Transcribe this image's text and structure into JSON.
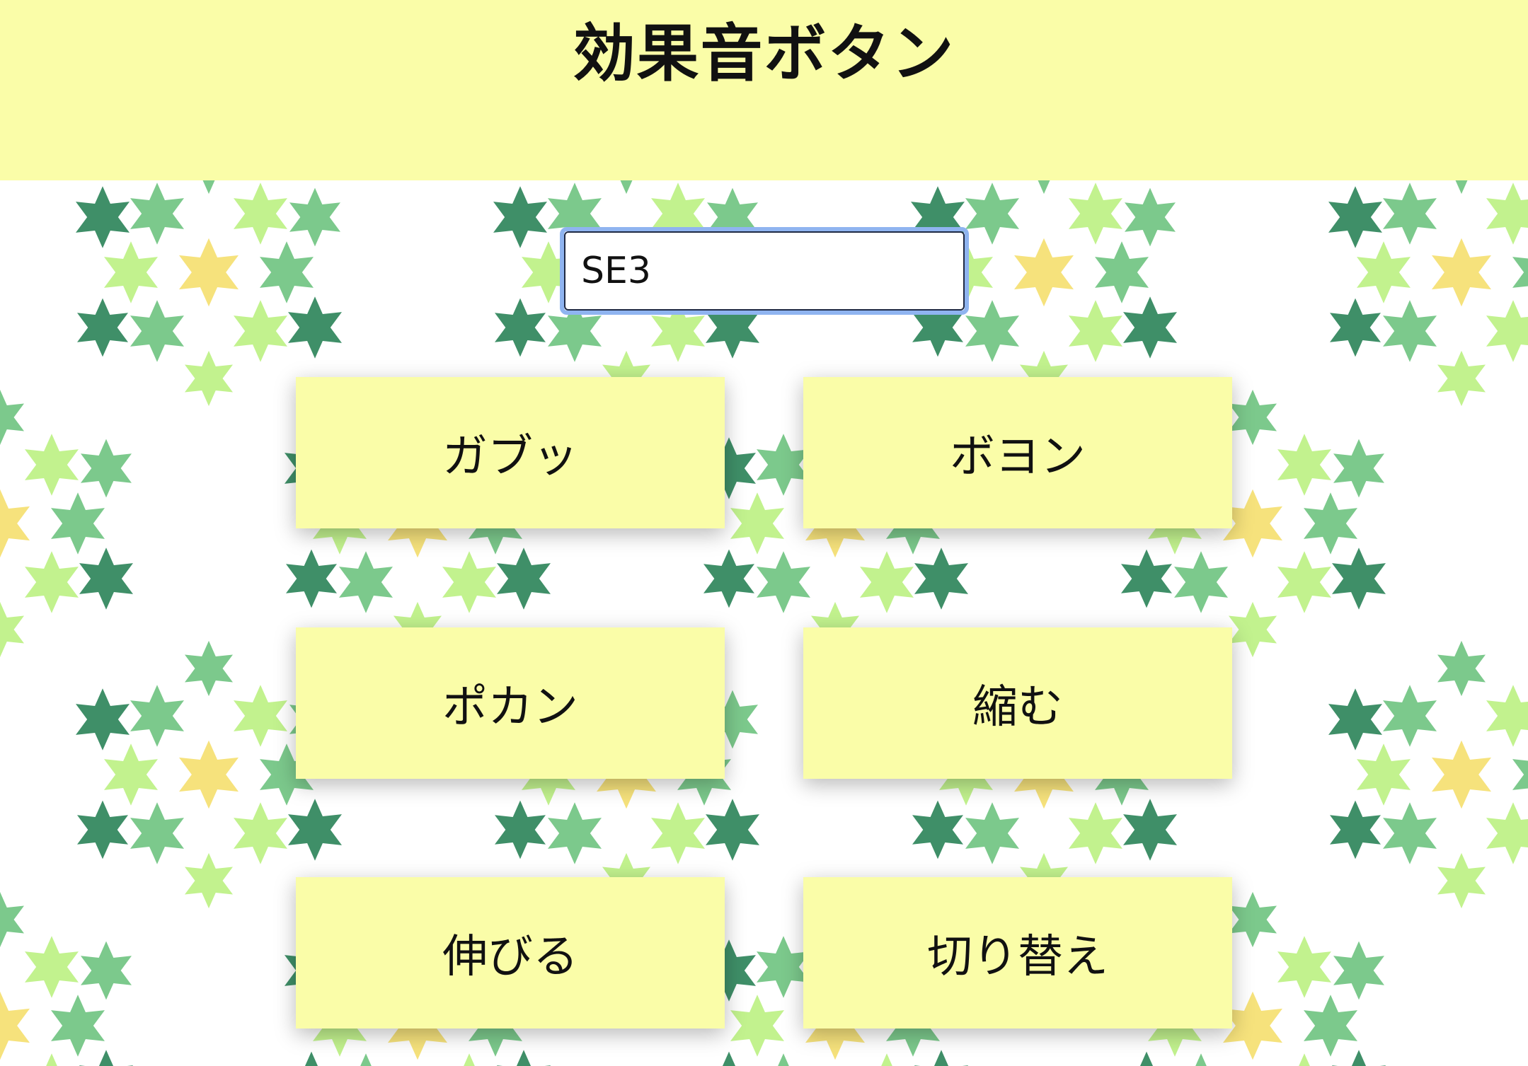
{
  "header": {
    "title": "効果音ボタン"
  },
  "sound_select": {
    "selected": "SE3"
  },
  "buttons": [
    {
      "label": "ガブッ"
    },
    {
      "label": "ボヨン"
    },
    {
      "label": "ポカン"
    },
    {
      "label": "縮む"
    },
    {
      "label": "伸びる"
    },
    {
      "label": "切り替え"
    }
  ],
  "colors": {
    "header_background": "#fafda8",
    "button_background": "#fafda8",
    "star_dark_green": "#3f8f68",
    "star_mid_green": "#7cc98c",
    "star_light_green": "#c2f28e",
    "star_yellow": "#f6e27c",
    "select_focus_ring": "#8fb4f0"
  },
  "background_pattern": {
    "icon": "star-of-david-icon",
    "description_colors": [
      "dark-green",
      "mid-green",
      "light-green",
      "yellow"
    ]
  }
}
